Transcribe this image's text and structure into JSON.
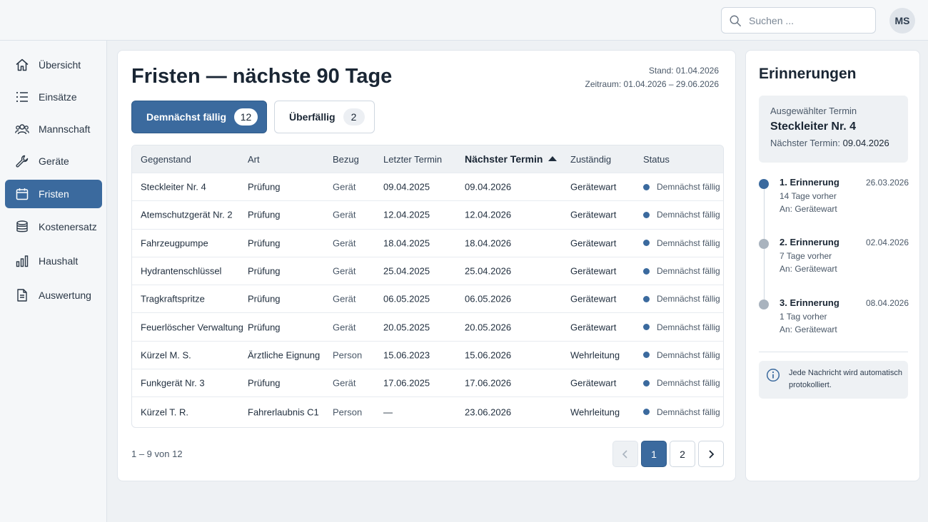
{
  "search": {
    "placeholder": "Suchen ...",
    "icon": "search-icon"
  },
  "user": {
    "initials": "MS"
  },
  "sidebar": {
    "items": [
      {
        "label": "Übersicht",
        "icon": "home-icon"
      },
      {
        "label": "Einsätze",
        "icon": "list-icon"
      },
      {
        "label": "Mannschaft",
        "icon": "users-icon"
      },
      {
        "label": "Geräte",
        "icon": "wrench-icon"
      },
      {
        "label": "Fristen",
        "icon": "calendar-icon",
        "active": true
      },
      {
        "label": "Kostenersatz",
        "icon": "coins-icon"
      },
      {
        "label": "Haushalt",
        "icon": "bar-chart-icon"
      },
      {
        "label": "Auswertung",
        "icon": "document-icon"
      }
    ]
  },
  "main": {
    "title": "Fristen — nächste 90 Tage",
    "stand": "Stand: 01.04.2026",
    "zeitraum": "Zeitraum: 01.04.2026 – 29.06.2026",
    "tabs": [
      {
        "label": "Demnächst fällig",
        "count": "12",
        "active": true
      },
      {
        "label": "Überfällig",
        "count": "2"
      }
    ],
    "table": {
      "columns": [
        "Gegenstand",
        "Art",
        "Bezug",
        "Letzter Termin",
        "Nächster Termin",
        "Zuständig",
        "Status"
      ],
      "rows": [
        [
          "Steckleiter Nr. 4",
          "Prüfung",
          "Gerät",
          "09.04.2025",
          "09.04.2026",
          "Gerätewart",
          "Demnächst fällig"
        ],
        [
          "Atemschutzgerät Nr. 2",
          "Prüfung",
          "Gerät",
          "12.04.2025",
          "12.04.2026",
          "Gerätewart",
          "Demnächst fällig"
        ],
        [
          "Fahrzeugpumpe",
          "Prüfung",
          "Gerät",
          "18.04.2025",
          "18.04.2026",
          "Gerätewart",
          "Demnächst fällig"
        ],
        [
          "Hydrantenschlüssel",
          "Prüfung",
          "Gerät",
          "25.04.2025",
          "25.04.2026",
          "Gerätewart",
          "Demnächst fällig"
        ],
        [
          "Tragkraftspritze",
          "Prüfung",
          "Gerät",
          "06.05.2025",
          "06.05.2026",
          "Gerätewart",
          "Demnächst fällig"
        ],
        [
          "Feuerlöscher Verwaltung",
          "Prüfung",
          "Gerät",
          "20.05.2025",
          "20.05.2026",
          "Gerätewart",
          "Demnächst fällig"
        ],
        [
          "Kürzel M. S.",
          "Ärztliche Eignung",
          "Person",
          "15.06.2023",
          "15.06.2026",
          "Wehrleitung",
          "Demnächst fällig"
        ],
        [
          "Funkgerät Nr. 3",
          "Prüfung",
          "Gerät",
          "17.06.2025",
          "17.06.2026",
          "Gerätewart",
          "Demnächst fällig"
        ],
        [
          "Kürzel T. R.",
          "Fahrerlaubnis C1",
          "Person",
          "—",
          "23.06.2026",
          "Wehrleitung",
          "Demnächst fällig"
        ]
      ]
    },
    "pagination": {
      "info": "1 – 9 von 12",
      "pages": [
        "1",
        "2"
      ],
      "current": "1"
    }
  },
  "aside": {
    "title": "Erinnerungen",
    "selected": {
      "label": "Ausgewählter Termin",
      "name": "Steckleiter Nr. 4",
      "next_label": "Nächster Termin:",
      "next_date": "09.04.2026"
    },
    "reminders": [
      {
        "name": "1. Erinnerung",
        "date": "26.03.2026",
        "before": "14 Tage vorher",
        "to": "An: Gerätewart"
      },
      {
        "name": "2. Erinnerung",
        "date": "02.04.2026",
        "before": "7 Tage vorher",
        "to": "An: Gerätewart"
      },
      {
        "name": "3. Erinnerung",
        "date": "08.04.2026",
        "before": "1 Tag vorher",
        "to": "An: Gerätewart"
      }
    ],
    "note": "Jede Nachricht wird automatisch protokolliert."
  },
  "colors": {
    "accent": "#3b6a9e",
    "background": "#eef1f4"
  }
}
